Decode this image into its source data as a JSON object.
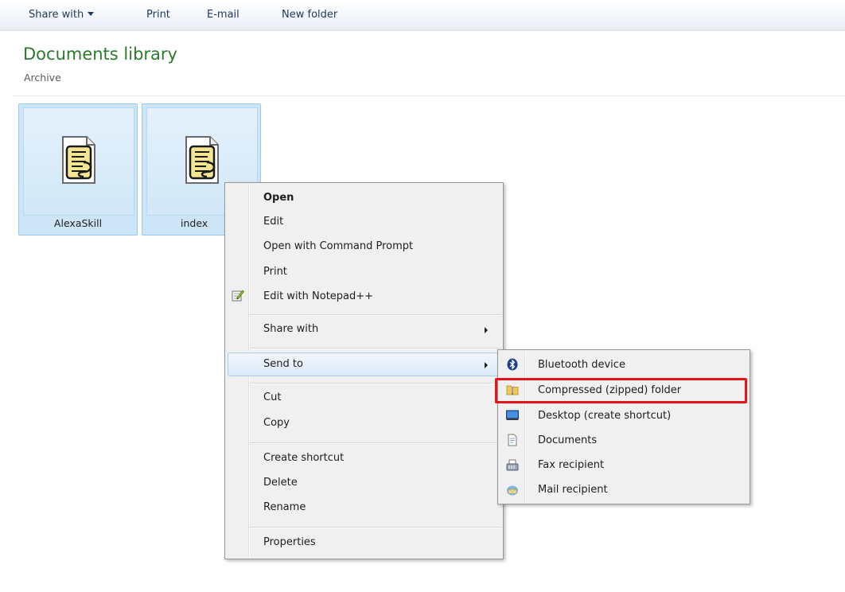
{
  "toolbar": {
    "share_with": "Share with",
    "print": "Print",
    "email": "E-mail",
    "new_folder": "New folder"
  },
  "header": {
    "title": "Documents library",
    "subtitle": "Archive"
  },
  "files": [
    {
      "name": "AlexaSkill",
      "icon": "script-file-icon"
    },
    {
      "name": "index",
      "icon": "script-file-icon"
    }
  ],
  "context_menu": {
    "open": "Open",
    "edit": "Edit",
    "open_cmd": "Open with Command Prompt",
    "print": "Print",
    "edit_npp": "Edit with Notepad++",
    "share_with": "Share with",
    "send_to": "Send to",
    "cut": "Cut",
    "copy": "Copy",
    "create_shortcut": "Create shortcut",
    "delete": "Delete",
    "rename": "Rename",
    "properties": "Properties"
  },
  "send_to_menu": {
    "bluetooth": "Bluetooth device",
    "compressed": "Compressed (zipped) folder",
    "desktop": "Desktop (create shortcut)",
    "documents": "Documents",
    "fax": "Fax recipient",
    "mail": "Mail recipient"
  },
  "colors": {
    "title_green": "#2a7a2a",
    "highlight_red": "#e8121b",
    "selection_blue": "#cde6f7"
  }
}
